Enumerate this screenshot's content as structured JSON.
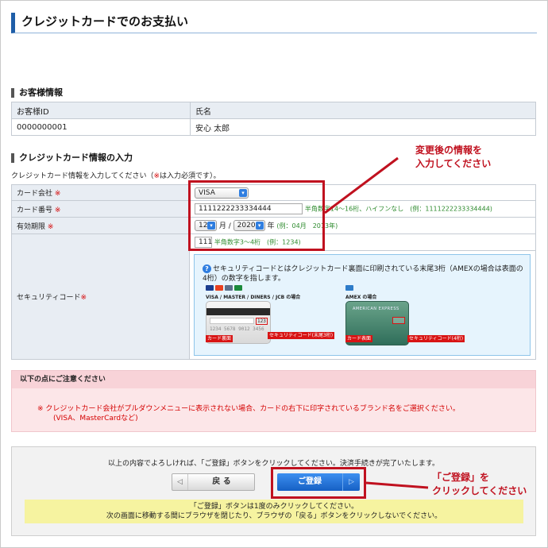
{
  "page": {
    "title": "クレジットカードでのお支払い"
  },
  "customer_section": {
    "heading": "お客様情報",
    "col_id": "お客様ID",
    "col_name": "氏名",
    "id_value": "0000000001",
    "name_value": "安心 太郎"
  },
  "card_section": {
    "heading": "クレジットカード情報の入力",
    "note_prefix": "クレジットカード情報を入力してください（",
    "note_mark": "※",
    "note_suffix": "は入力必須です）。",
    "required_mark": "※",
    "company_label": "カード会社",
    "company_value": "VISA",
    "number_label": "カード番号",
    "number_value": "1111222233334444",
    "number_hint": "半角数字14～16桁、ハイフンなし　(例：1111222233334444)",
    "expiry_label": "有効期限",
    "expiry_month": "12",
    "expiry_month_unit": "月 /",
    "expiry_year": "2020",
    "expiry_year_unit": "年",
    "expiry_hint": "(例：04月　2013年)",
    "security_label": "セキュリティコード",
    "security_value": "111",
    "security_hint": "半角数字3～4桁　(例：1234)",
    "security_info": "セキュリティコードとはクレジットカード裏面に印刷されている末尾3桁（AMEXの場合は表面の4桁）の数字を指します。",
    "visa_caption": "VISA / MASTER / DINERS / JCB の場合",
    "amex_caption": "AMEX の場合",
    "card_back_label": "カード裏面",
    "card_front_label": "カード表面",
    "back_code_label": "セキュリティコード(末尾3桁)",
    "amex_code_label": "セキュリティコード(4桁)",
    "back_card_number": "1234 5678 9012 3456",
    "back_card_code": "123",
    "amex_brand": "AMERICAN EXPRESS"
  },
  "caution": {
    "heading": "以下の点にご注意ください",
    "line1": "※ クレジットカード会社がプルダウンメニューに表示されない場合、カードの右下に印字されているブランド名をご選択ください。",
    "line2": "(VISA、MasterCardなど)"
  },
  "confirm": {
    "message": "以上の内容でよろしければ、「ご登録」ボタンをクリックしてください。決済手続きが完了いたします。",
    "back_button": "戻 る",
    "register_button": "ご登録",
    "notice_line1": "「ご登録」ボタンは1度のみクリックしてください。",
    "notice_line2": "次の画面に移動する間にブラウザを閉じたり、ブラウザの「戻る」ボタンをクリックしないでください。"
  },
  "annotations": {
    "top_line1": "変更後の情報を",
    "top_line2": "入力してください",
    "bottom_line1": "「ご登録」を",
    "bottom_line2": "クリックしてください"
  },
  "colors": {
    "accent_blue": "#1f5ea8",
    "annotation_red": "#c0111f",
    "hint_green": "#2e8b2e",
    "caution_pink": "#fce6e8",
    "notice_yellow": "#f6f3a0"
  }
}
